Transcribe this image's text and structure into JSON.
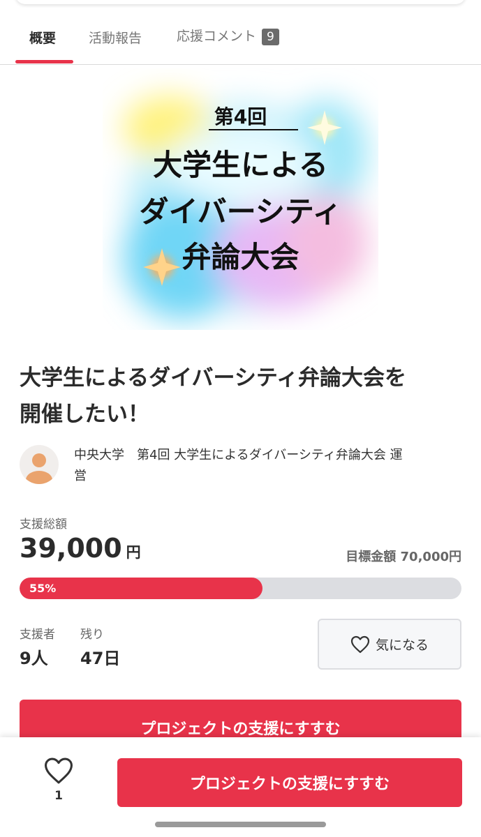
{
  "tabs": [
    {
      "label": "概要",
      "active": true
    },
    {
      "label": "活動報告",
      "active": false
    },
    {
      "label": "応援コメント",
      "count": "9",
      "active": false
    }
  ],
  "hero": {
    "edition": "第4回",
    "line1": "大学生による",
    "line2": "ダイバーシティ",
    "line3": "弁論大会"
  },
  "project": {
    "title_line1": "大学生によるダイバーシティ弁論大会を",
    "title_line2": "開催したい！",
    "owner_line1": "中央大学　第4回 大学生によるダイバーシティ弁論大会 運",
    "owner_line2": "営"
  },
  "funding": {
    "total_label": "支援総額",
    "amount": "39,000",
    "unit": "円",
    "goal_text": "目標金額 70,000円",
    "progress_percent": 55,
    "progress_label": "55%",
    "supporters_label": "支援者",
    "supporters_value": "9人",
    "remaining_label": "残り",
    "remaining_value": "47日"
  },
  "actions": {
    "watch_label": "気になる",
    "support_label": "プロジェクトの支援にすすむ"
  },
  "bottom_bar": {
    "like_count": "1",
    "support_label": "プロジェクトの支援にすすむ"
  },
  "colors": {
    "accent": "#e8334a",
    "track": "#dcdde1"
  },
  "icons": {
    "like": "heart-outline-icon",
    "watch": "heart-outline-icon",
    "avatar": "user-avatar-icon"
  }
}
